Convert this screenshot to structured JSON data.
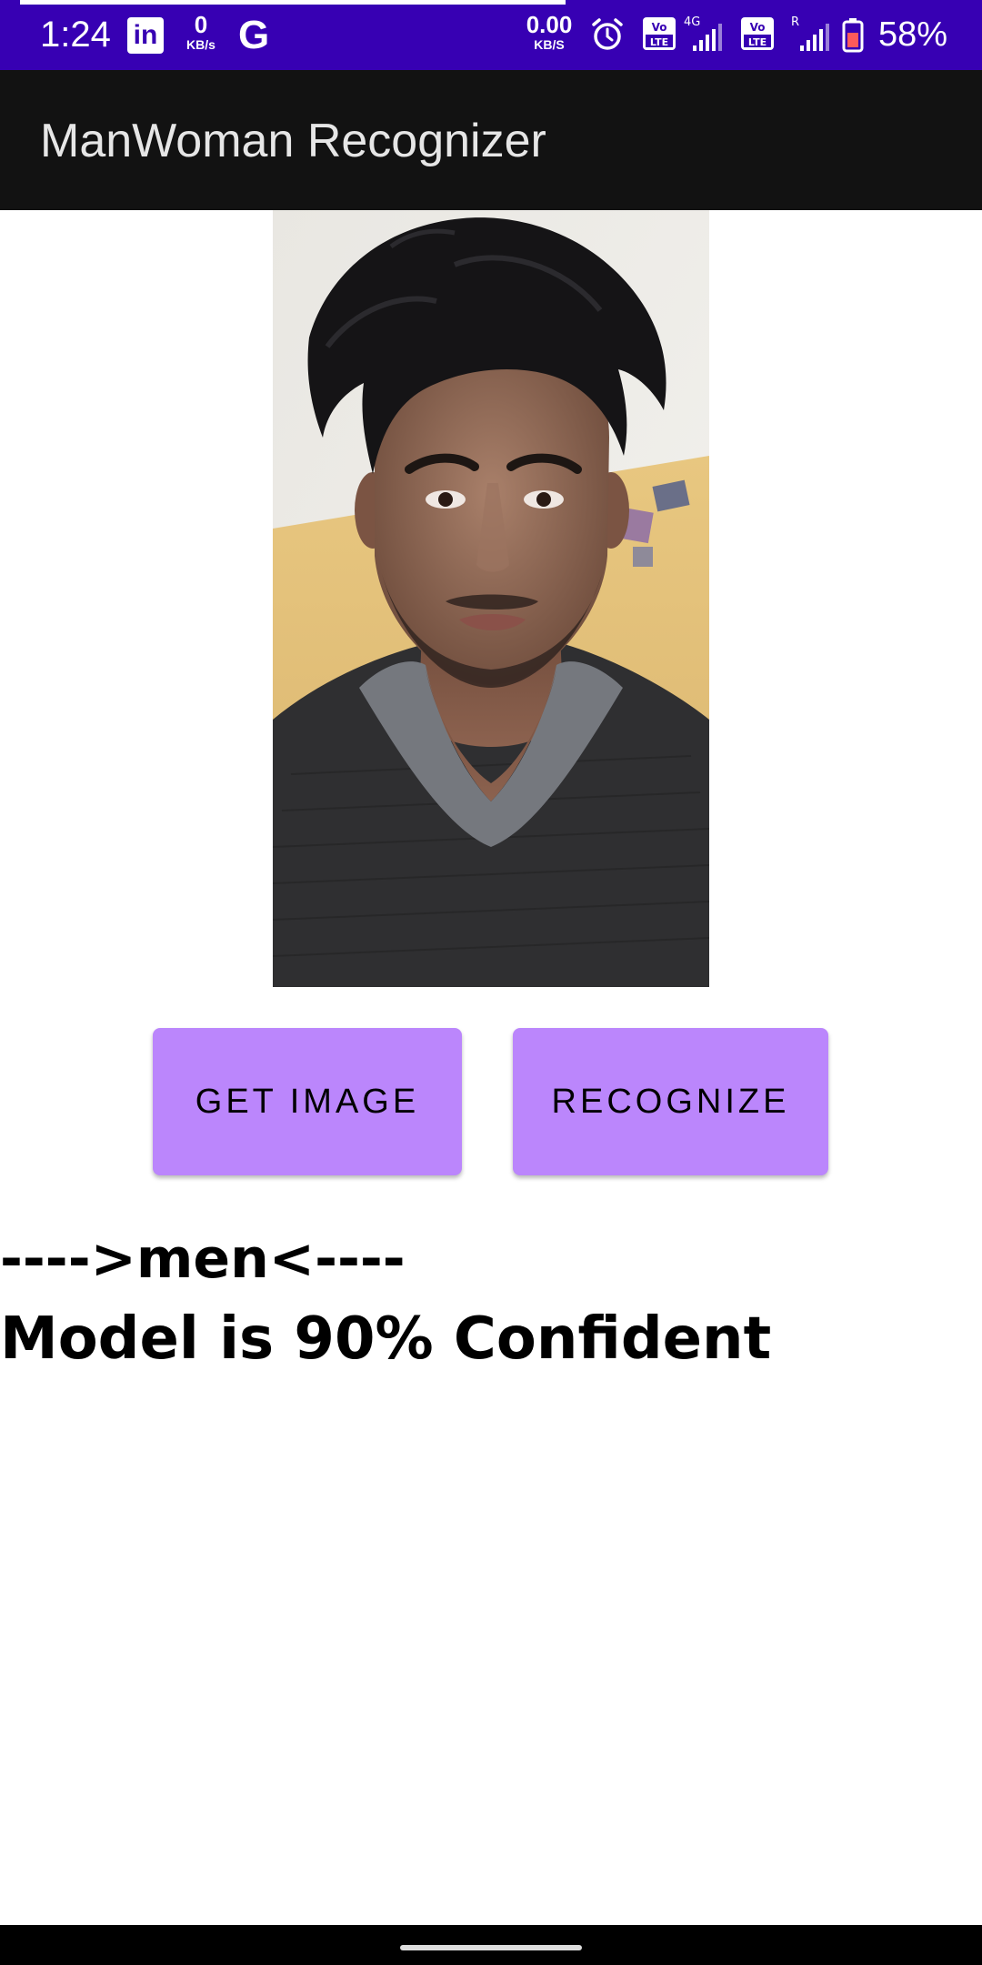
{
  "status_bar": {
    "time": "1:24",
    "linkedin_glyph": "in",
    "netspeed_left": {
      "value": "0",
      "unit": "KB/s"
    },
    "google_glyph": "G",
    "netspeed_right": {
      "value": "0.00",
      "unit": "KB/S"
    },
    "volte_label": "Vo LTE",
    "network_type": "4G",
    "roaming_flag": "R",
    "battery": "58%",
    "icons": [
      "linkedin-icon",
      "google-icon",
      "alarm-icon",
      "volte-icon",
      "signal-icon",
      "battery-icon"
    ],
    "background_color": "#3700b3"
  },
  "app_bar": {
    "title": "ManWoman Recognizer",
    "background_color": "#121212"
  },
  "photo": {
    "alt": "selected face photo"
  },
  "buttons": {
    "get_image": "GET IMAGE",
    "recognize": "RECOGNIZE",
    "color": "#bb86fc"
  },
  "result": {
    "label": "---->men<----",
    "confidence": "Model is 90% Confident"
  }
}
